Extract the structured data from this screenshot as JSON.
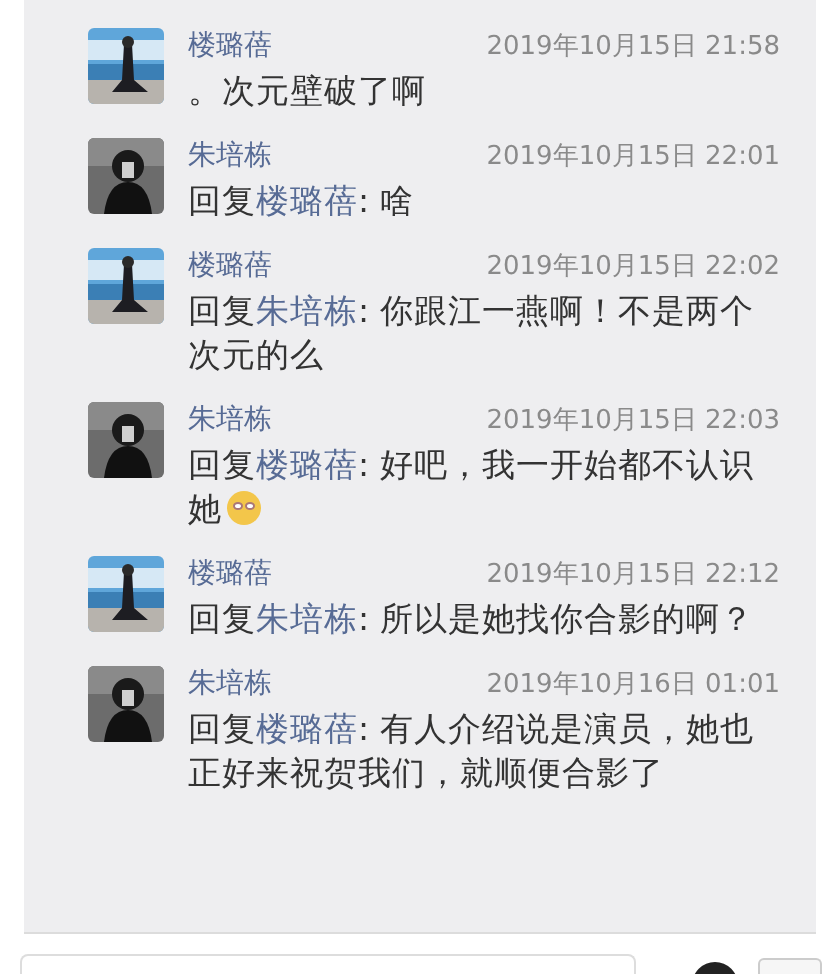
{
  "comments": [
    {
      "author": "楼璐蓓",
      "time": "2019年10月15日 21:58",
      "text": "。次元壁破了啊"
    },
    {
      "author": "朱培栋",
      "time": "2019年10月15日 22:01",
      "prefix": "回复",
      "reply_to": "楼璐蓓",
      "text": ": 啥"
    },
    {
      "author": "楼璐蓓",
      "time": "2019年10月15日 22:02",
      "prefix": "回复",
      "reply_to": "朱培栋",
      "text": ": 你跟江一燕啊！不是两个次元的么"
    },
    {
      "author": "朱培栋",
      "time": "2019年10月15日 22:03",
      "prefix": "回复",
      "reply_to": "楼璐蓓",
      "text": ": 好吧，我一开始都不认识她",
      "emoji": true
    },
    {
      "author": "楼璐蓓",
      "time": "2019年10月15日 22:12",
      "prefix": "回复",
      "reply_to": "朱培栋",
      "text": ": 所以是她找你合影的啊？"
    },
    {
      "author": "朱培栋",
      "time": "2019年10月16日 01:01",
      "prefix": "回复",
      "reply_to": "楼璐蓓",
      "text": ": 有人介绍说是演员，她也正好来祝贺我们，就顺便合影了"
    }
  ]
}
